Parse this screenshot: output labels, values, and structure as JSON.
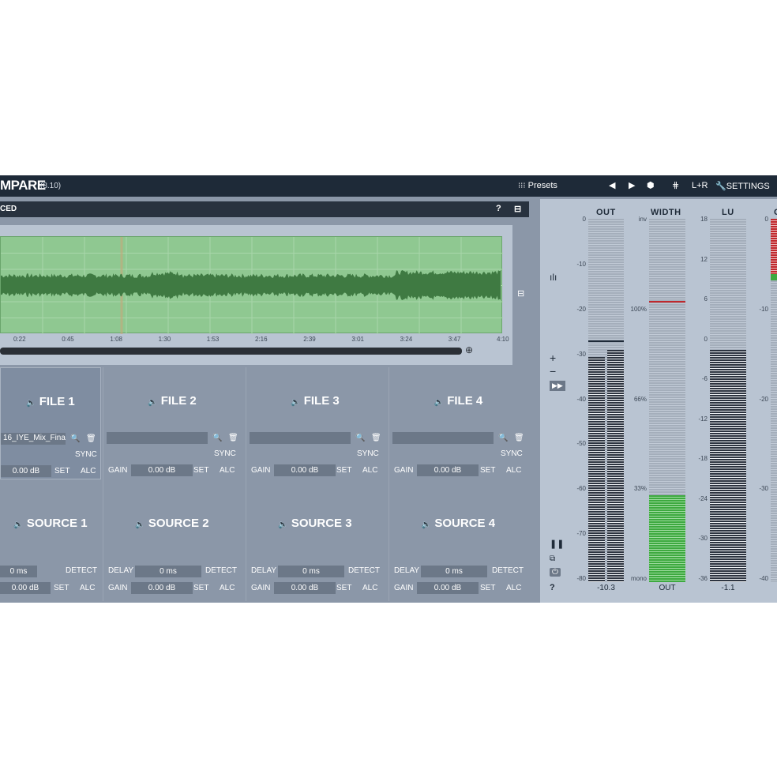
{
  "app": {
    "title": "MPARE",
    "version": "(8.10)"
  },
  "toolbar": {
    "presets": "Presets",
    "prev": "◀",
    "next": "▶",
    "random": "⬢",
    "channel_icon": "⋕",
    "channel": "L+R",
    "settings": "SETTINGS"
  },
  "advanced": {
    "label": "CED",
    "help": "?",
    "collapse": "⊟"
  },
  "waveform": {
    "ticks": [
      "0:22",
      "0:45",
      "1:08",
      "1:30",
      "1:53",
      "2:16",
      "2:39",
      "3:01",
      "3:24",
      "3:47",
      "4:10"
    ]
  },
  "files": [
    {
      "title": "FILE 1",
      "filename": "16_IYE_Mix_Fina",
      "sync": "SYNC",
      "gain_label": "",
      "gain": "0.00 dB",
      "set": "SET",
      "alc": "ALC"
    },
    {
      "title": "FILE 2",
      "filename": "",
      "sync": "SYNC",
      "gain_label": "GAIN",
      "gain": "0.00 dB",
      "set": "SET",
      "alc": "ALC"
    },
    {
      "title": "FILE 3",
      "filename": "",
      "sync": "SYNC",
      "gain_label": "GAIN",
      "gain": "0.00 dB",
      "set": "SET",
      "alc": "ALC"
    },
    {
      "title": "FILE 4",
      "filename": "",
      "sync": "SYNC",
      "gain_label": "GAIN",
      "gain": "0.00 dB",
      "set": "SET",
      "alc": "ALC"
    }
  ],
  "sources": [
    {
      "title": "SOURCE 1",
      "delay_label": "",
      "delay": "0 ms",
      "detect": "DETECT",
      "gain_label": "",
      "gain": "0.00 dB",
      "set": "SET",
      "alc": "ALC"
    },
    {
      "title": "SOURCE 2",
      "delay_label": "DELAY",
      "delay": "0 ms",
      "detect": "DETECT",
      "gain_label": "GAIN",
      "gain": "0.00 dB",
      "set": "SET",
      "alc": "ALC"
    },
    {
      "title": "SOURCE 3",
      "delay_label": "DELAY",
      "delay": "0 ms",
      "detect": "DETECT",
      "gain_label": "GAIN",
      "gain": "0.00 dB",
      "set": "SET",
      "alc": "ALC"
    },
    {
      "title": "SOURCE 4",
      "delay_label": "DELAY",
      "delay": "0 ms",
      "detect": "DETECT",
      "gain_label": "GAIN",
      "gain": "0.00 dB",
      "set": "SET",
      "alc": "ALC"
    }
  ],
  "meters": {
    "out": {
      "label": "OUT",
      "scale": [
        "0",
        "-10",
        "-20",
        "-30",
        "-40",
        "-50",
        "-60",
        "-70",
        "-80"
      ],
      "value": "-10.3",
      "left_level": 0.62,
      "right_level": 0.64,
      "peak_level": 0.66
    },
    "width": {
      "label": "WIDTH",
      "scale": [
        "inv",
        "100%",
        "66%",
        "33%",
        "mono"
      ],
      "footer": "OUT",
      "level": 0.24,
      "peak_level": 0.77
    },
    "lu": {
      "label": "LU",
      "scale": [
        "18",
        "12",
        "6",
        "0",
        "-6",
        "-12",
        "-18",
        "-24",
        "-30",
        "-36"
      ],
      "value": "-1.1",
      "level": 0.64
    },
    "fourth": {
      "label": "C",
      "scale": [
        "0",
        "-10",
        "-20",
        "-30",
        "-40"
      ]
    },
    "colors": {
      "bar": "#2d3440",
      "green": "#3da93f",
      "peak": "#c0282d"
    }
  }
}
